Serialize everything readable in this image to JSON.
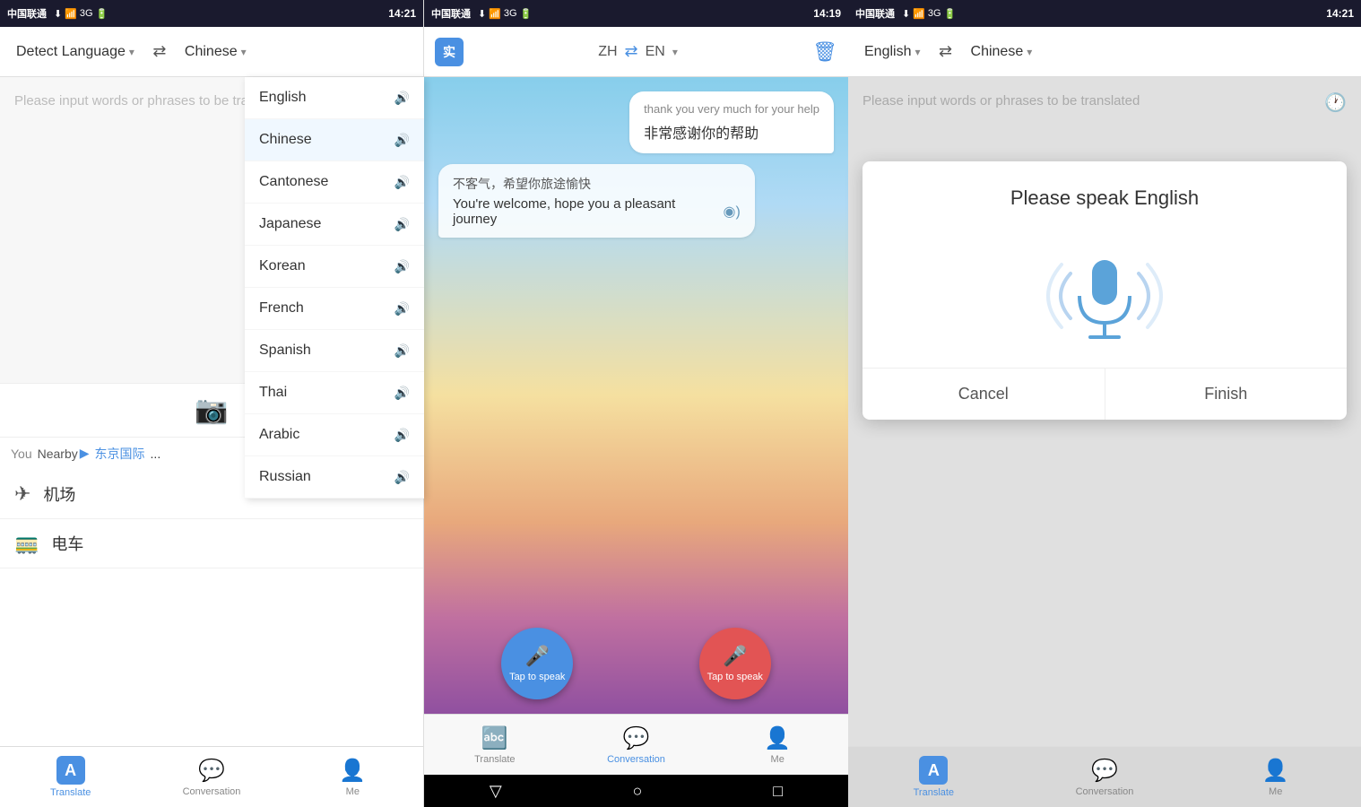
{
  "panel1": {
    "status": {
      "carrier": "中国联通",
      "time": "14:21"
    },
    "toolbar": {
      "source_lang": "Detect Language",
      "target_lang": "Chinese"
    },
    "input": {
      "placeholder": "Please input words or phrases to be translated"
    },
    "location": {
      "you_label": "You",
      "nearby_label": "Nearby",
      "place": "东京国际"
    },
    "quick_links": [
      {
        "icon": "✈",
        "label": "机场"
      },
      {
        "icon": "🚃",
        "label": "电车"
      }
    ],
    "dropdown": {
      "items": [
        {
          "label": "English",
          "selected": false
        },
        {
          "label": "Chinese",
          "selected": true
        },
        {
          "label": "Cantonese",
          "selected": false
        },
        {
          "label": "Japanese",
          "selected": false
        },
        {
          "label": "Korean",
          "selected": false
        },
        {
          "label": "French",
          "selected": false
        },
        {
          "label": "Spanish",
          "selected": false
        },
        {
          "label": "Thai",
          "selected": false
        },
        {
          "label": "Arabic",
          "selected": false
        },
        {
          "label": "Russian",
          "selected": false
        }
      ]
    },
    "nav": {
      "translate": "Translate",
      "conversation": "Conversation",
      "me": "Me"
    }
  },
  "panel2": {
    "status": {
      "carrier": "中国联通",
      "time": "14:19"
    },
    "toolbar": {
      "zh_code": "ZH",
      "en_code": "EN"
    },
    "conversation": {
      "bubble1": {
        "source": "thank you very much for your help",
        "translated": "非常感谢你的帮助"
      },
      "bubble2": {
        "source": "不客气，希望你旅途愉快",
        "translated": "You're welcome, hope you a pleasant journey"
      }
    },
    "speak_btn1": {
      "label": "Tap to speak"
    },
    "speak_btn2": {
      "label": "Tap to speak"
    },
    "nav": {
      "translate": "Translate",
      "conversation": "Conversation",
      "me": "Me"
    }
  },
  "panel3": {
    "status": {
      "carrier": "中国联通",
      "time": "14:21"
    },
    "toolbar": {
      "source_lang": "English",
      "target_lang": "Chinese"
    },
    "input": {
      "placeholder": "Please input words or phrases to be translated"
    },
    "dialog": {
      "title": "Please speak English",
      "cancel_label": "Cancel",
      "finish_label": "Finish"
    },
    "nav": {
      "translate": "Translate",
      "conversation": "Conversation",
      "me": "Me"
    }
  }
}
